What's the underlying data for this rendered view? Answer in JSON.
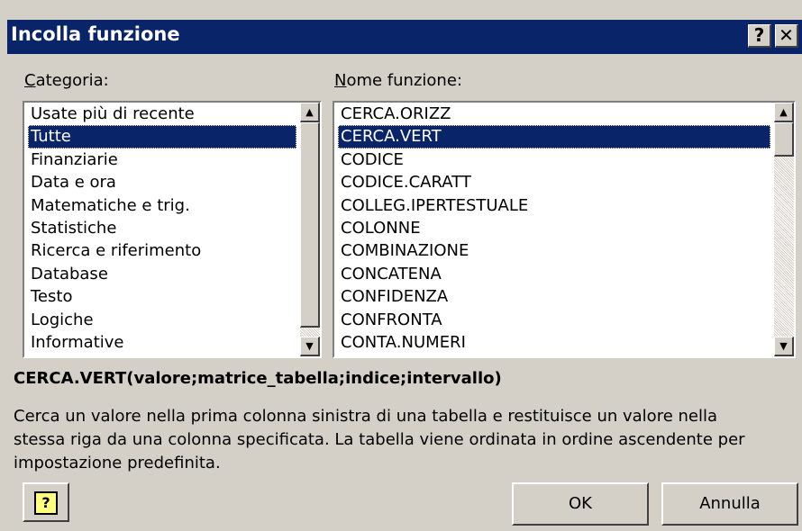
{
  "window": {
    "title": "Incolla funzione",
    "help_glyph": "?",
    "close_glyph": "✕"
  },
  "categories": {
    "label_accel": "C",
    "label_rest": "ategoria:",
    "items": [
      "Usate più di recente",
      "Tutte",
      "Finanziarie",
      "Data e ora",
      "Matematiche e trig.",
      "Statistiche",
      "Ricerca e riferimento",
      "Database",
      "Testo",
      "Logiche",
      "Informative"
    ],
    "selected": "Tutte"
  },
  "functions": {
    "label_accel": "N",
    "label_rest": "ome funzione:",
    "items": [
      "CERCA.ORIZZ",
      "CERCA.VERT",
      "CODICE",
      "CODICE.CARATT",
      "COLLEG.IPERTESTUALE",
      "COLONNE",
      "COMBINAZIONE",
      "CONCATENA",
      "CONFIDENZA",
      "CONFRONTA",
      "CONTA.NUMERI"
    ],
    "selected": "CERCA.VERT"
  },
  "syntax": "CERCA.VERT(valore;matrice_tabella;indice;intervallo)",
  "description": "Cerca un valore nella prima colonna sinistra di una tabella e restituisce un valore nella stessa riga da una colonna specificata. La tabella viene ordinata in ordine ascendente per impostazione predefinita.",
  "buttons": {
    "help_glyph": "?",
    "ok": "OK",
    "cancel": "Annulla"
  },
  "icons": {
    "up_arrow": "▲",
    "down_arrow": "▼"
  }
}
